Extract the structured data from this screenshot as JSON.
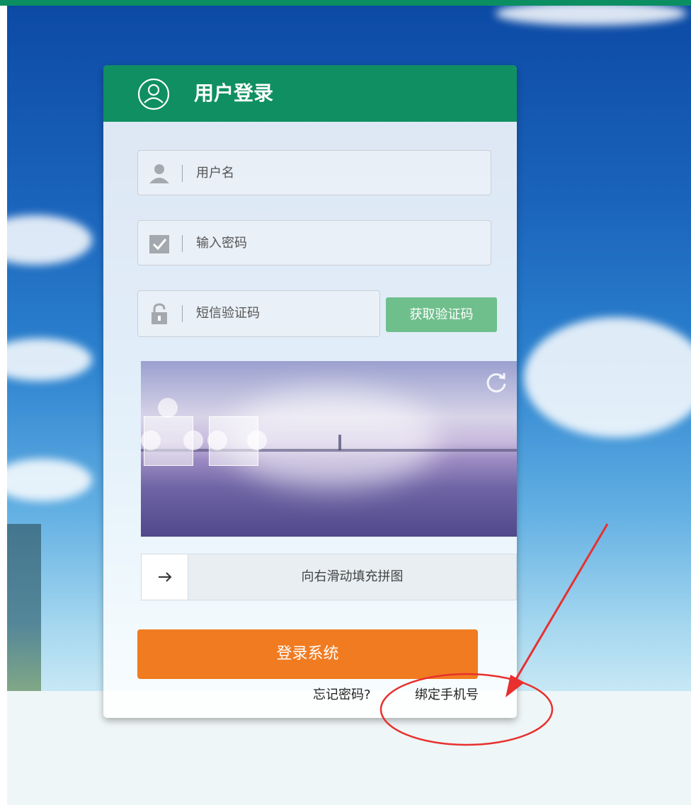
{
  "header": {
    "title": "用户登录"
  },
  "form": {
    "username_placeholder": "用户名",
    "password_placeholder": "输入密码",
    "sms_placeholder": "短信验证码",
    "get_code_label": "获取验证码"
  },
  "captcha": {
    "slider_hint": "向右滑动填充拼图"
  },
  "actions": {
    "login_label": "登录系统",
    "forgot_label": "忘记密码?",
    "bind_label": "绑定手机号"
  },
  "icons": {
    "header": "user-circle-icon",
    "username": "user-icon",
    "password": "checkbox-icon",
    "sms": "lock-icon",
    "refresh": "refresh-icon",
    "slider": "arrow-right-icon"
  },
  "colors": {
    "brand_green": "#0f8f62",
    "sms_button": "#6fbf8c",
    "login_button": "#f17b21",
    "annotation_red": "#e8302e"
  }
}
